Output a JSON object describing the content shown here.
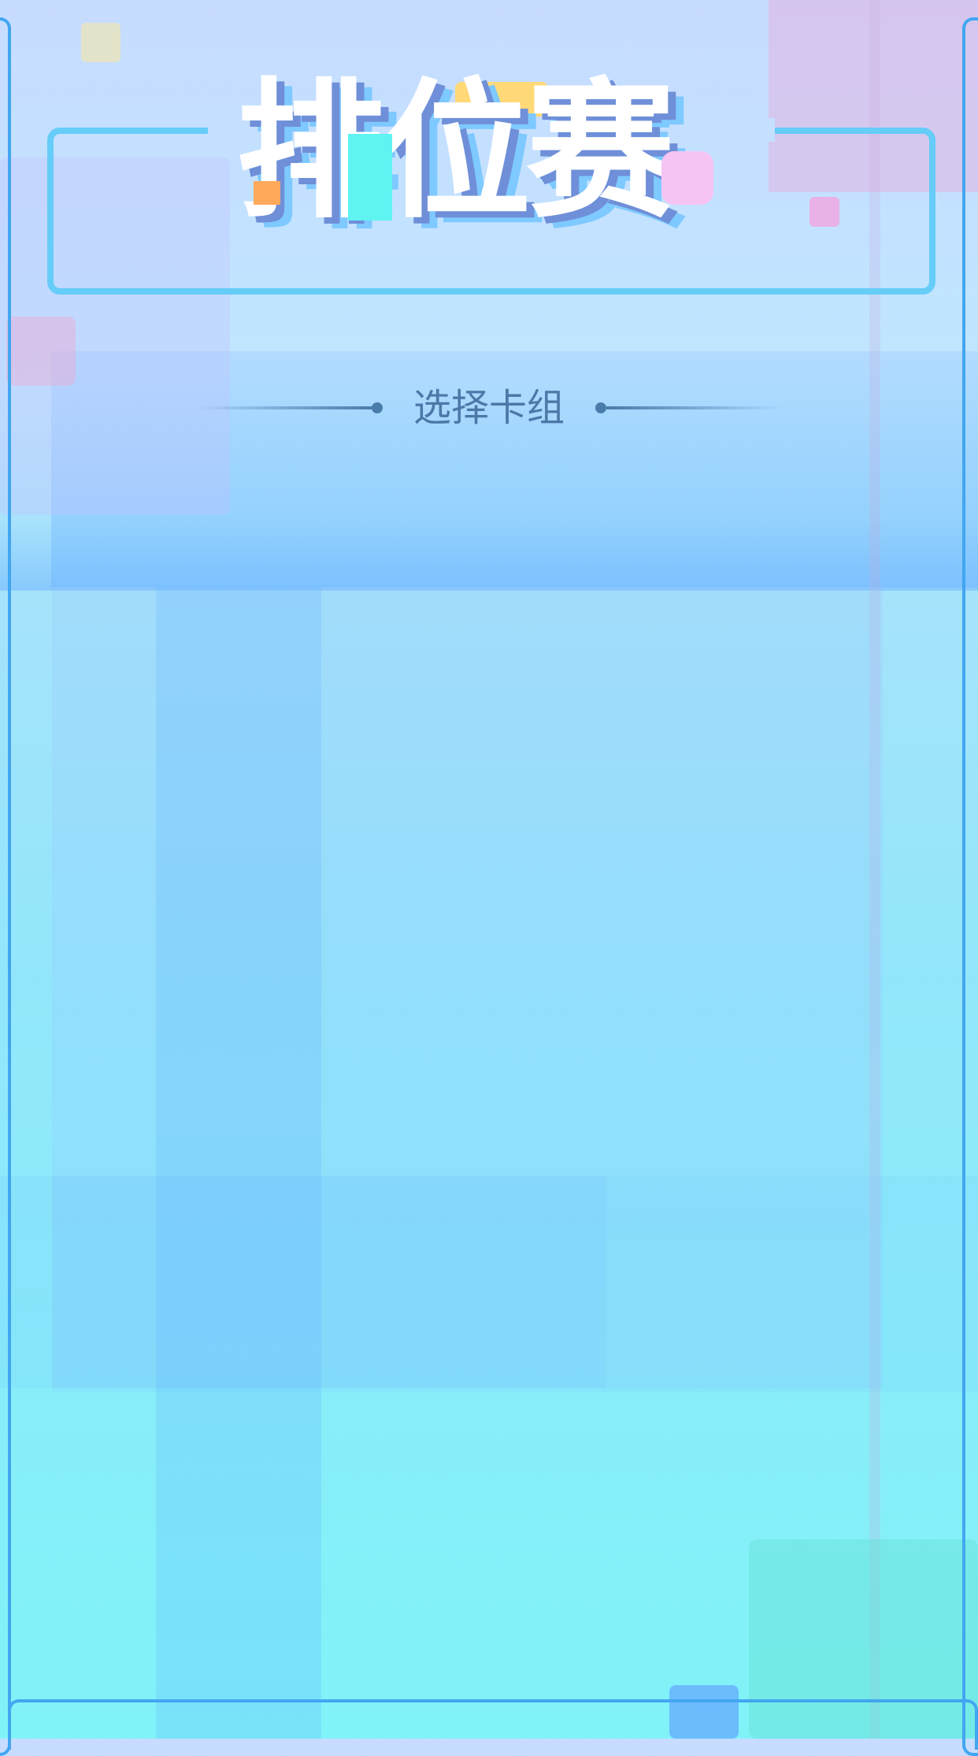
{
  "title": "排位赛",
  "subtitle": "选择卡组",
  "colors": {
    "frame": "#42a6f0",
    "title_box": "#66ccf8",
    "title_main": "#ffffff",
    "title_shadow": "#6f8fd8",
    "subtitle": "#4c78a8"
  }
}
